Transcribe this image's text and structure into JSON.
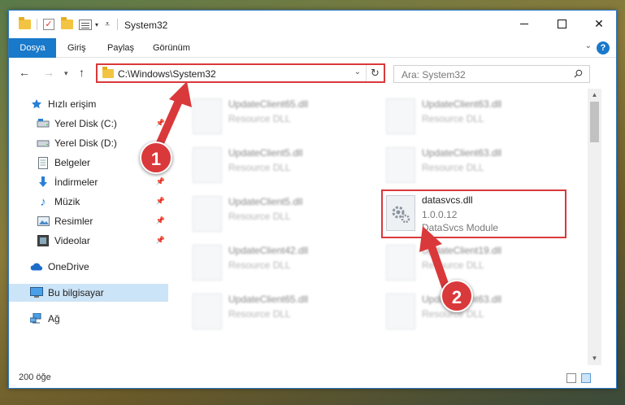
{
  "window": {
    "title": "System32",
    "controls": {
      "minimize": "",
      "maximize": "",
      "close": "✕"
    }
  },
  "ribbon": {
    "tabs": [
      "Dosya",
      "Giriş",
      "Paylaş",
      "Görünüm"
    ],
    "help": "?"
  },
  "navigation": {
    "address_path": "C:\\Windows\\System32",
    "search_placeholder": "Ara: System32"
  },
  "nav_pane": {
    "quick_access": "Hızlı erişim",
    "items": [
      {
        "label": "Yerel Disk (C:)",
        "icon": "drive-icon",
        "pinned": true
      },
      {
        "label": "Yerel Disk (D:)",
        "icon": "drive-icon",
        "pinned": false
      },
      {
        "label": "Belgeler",
        "icon": "documents-icon",
        "pinned": true
      },
      {
        "label": "İndirmeler",
        "icon": "download-icon",
        "pinned": true
      },
      {
        "label": "Müzik",
        "icon": "music-icon",
        "pinned": true
      },
      {
        "label": "Resimler",
        "icon": "pictures-icon",
        "pinned": true
      },
      {
        "label": "Videolar",
        "icon": "video-icon",
        "pinned": true
      }
    ],
    "onedrive": "OneDrive",
    "this_pc": "Bu bilgisayar",
    "network": "Ağ"
  },
  "files": [
    {
      "name": "UpdateClient65.dll",
      "sub": "Resource DLL"
    },
    {
      "name": "UpdateClient63.dll",
      "sub": "Resource DLL"
    },
    {
      "name": "UpdateClient5.dll",
      "sub": "Resource DLL"
    },
    {
      "name": "UpdateClient63.dll",
      "sub": "Resource DLL"
    },
    {
      "name": "UpdateClient5.dll",
      "sub": "Resource DLL"
    },
    {
      "name": "datasvcs.dll",
      "version": "1.0.0.12",
      "sub": "DataSvcs Module"
    },
    {
      "name": "UpdateClient42.dll",
      "sub": "Resource DLL"
    },
    {
      "name": "UpdateClient19.dll",
      "sub": "Resource DLL"
    },
    {
      "name": "UpdateClient65.dll",
      "sub": "Resource DLL"
    },
    {
      "name": "UpdateClient63.dll",
      "sub": "Resource DLL"
    }
  ],
  "status": {
    "item_count": "200 öğe"
  },
  "annotations": {
    "step1": "1",
    "step2": "2",
    "color": "#d9393b"
  }
}
